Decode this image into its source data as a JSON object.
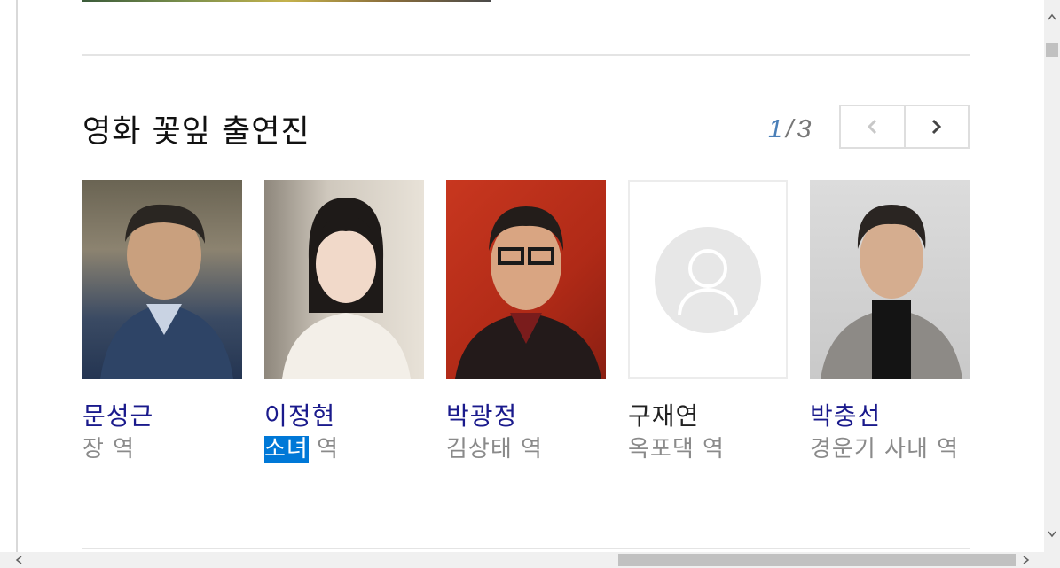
{
  "section": {
    "title": "영화 꽃잎 출연진"
  },
  "pager": {
    "current": "1",
    "separator": "/",
    "total": "3"
  },
  "nav": {
    "prev_icon": "chevron-left-icon",
    "next_icon": "chevron-right-icon"
  },
  "cast": [
    {
      "name": "문성근",
      "role": "장 역"
    },
    {
      "name": "이정현",
      "role_highlight": "소녀",
      "role_rest": " 역"
    },
    {
      "name": "박광정",
      "role": "김상태 역"
    },
    {
      "name": "구재연",
      "role": "옥포댁 역"
    },
    {
      "name": "박충선",
      "role": "경운기 사내 역"
    }
  ],
  "colors": {
    "name_link": "#1a1a8c",
    "pager_current": "#4a7fb8",
    "selection": "#0078d7"
  }
}
